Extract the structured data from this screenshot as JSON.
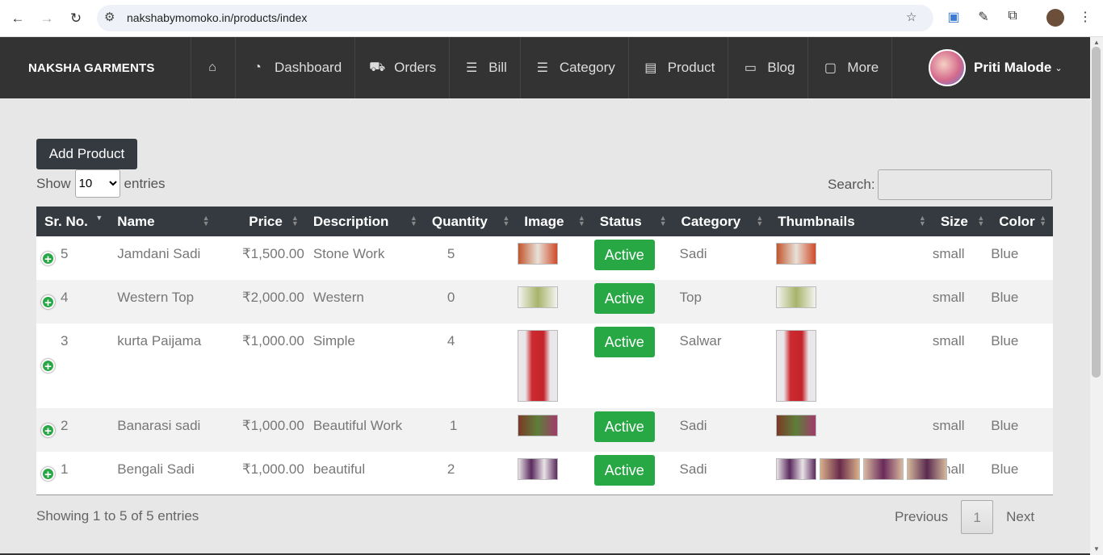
{
  "browser": {
    "url": "nakshabymomoko.in/products/index",
    "icons": [
      "back-icon",
      "forward-icon",
      "reload-icon",
      "site-info-icon",
      "star-icon",
      "extension-icon",
      "eyedropper-icon",
      "puzzle-icon",
      "profile-icon",
      "kebab-icon"
    ]
  },
  "header": {
    "brand": "NAKSHA GARMENTS",
    "menu": [
      {
        "label": "",
        "icon": "home-icon"
      },
      {
        "label": "Dashboard",
        "icon": "dashboard-icon"
      },
      {
        "label": "Orders",
        "icon": "cart-icon"
      },
      {
        "label": "Bill",
        "icon": "list-icon"
      },
      {
        "label": "Category",
        "icon": "list-icon"
      },
      {
        "label": "Product",
        "icon": "product-icon"
      },
      {
        "label": "Blog",
        "icon": "newspaper-icon"
      },
      {
        "label": "More",
        "icon": "monitor-icon"
      }
    ],
    "user": "Priti Malode"
  },
  "toolbar": {
    "add_label": "Add Product",
    "show_label": "Show",
    "entries_label": "entries",
    "page_size": "10",
    "search_label": "Search:"
  },
  "table": {
    "columns": [
      "Sr. No.",
      "Name",
      "Price",
      "Description",
      "Quantity",
      "Image",
      "Status",
      "Category",
      "Thumbnails",
      "Size",
      "Color"
    ],
    "rows": [
      {
        "sr": "5",
        "name": "Jamdani Sadi",
        "price": "₹1,500.00",
        "desc": "Stone Work",
        "qty": "5",
        "status": "Active",
        "category": "Sadi",
        "size": "small",
        "color": "Blue"
      },
      {
        "sr": "4",
        "name": "Western Top",
        "price": "₹2,000.00",
        "desc": "Western",
        "qty": "0",
        "status": "Active",
        "category": "Top",
        "size": "small",
        "color": "Blue"
      },
      {
        "sr": "3",
        "name": "kurta Paijama",
        "price": "₹1,000.00",
        "desc": "Simple",
        "qty": "4",
        "status": "Active",
        "category": "Salwar",
        "size": "small",
        "color": "Blue"
      },
      {
        "sr": "2",
        "name": "Banarasi sadi",
        "price": "₹1,000.00",
        "desc": "Beautiful Work",
        "qty": "1",
        "status": "Active",
        "category": "Sadi",
        "size": "small",
        "color": "Blue"
      },
      {
        "sr": "1",
        "name": "Bengali Sadi",
        "price": "₹1,000.00",
        "desc": "beautiful",
        "qty": "2",
        "status": "Active",
        "category": "Sadi",
        "size": "small",
        "color": "Blue"
      }
    ]
  },
  "footer": {
    "info": "Showing 1 to 5 of 5 entries",
    "prev": "Previous",
    "page": "1",
    "next": "Next"
  }
}
